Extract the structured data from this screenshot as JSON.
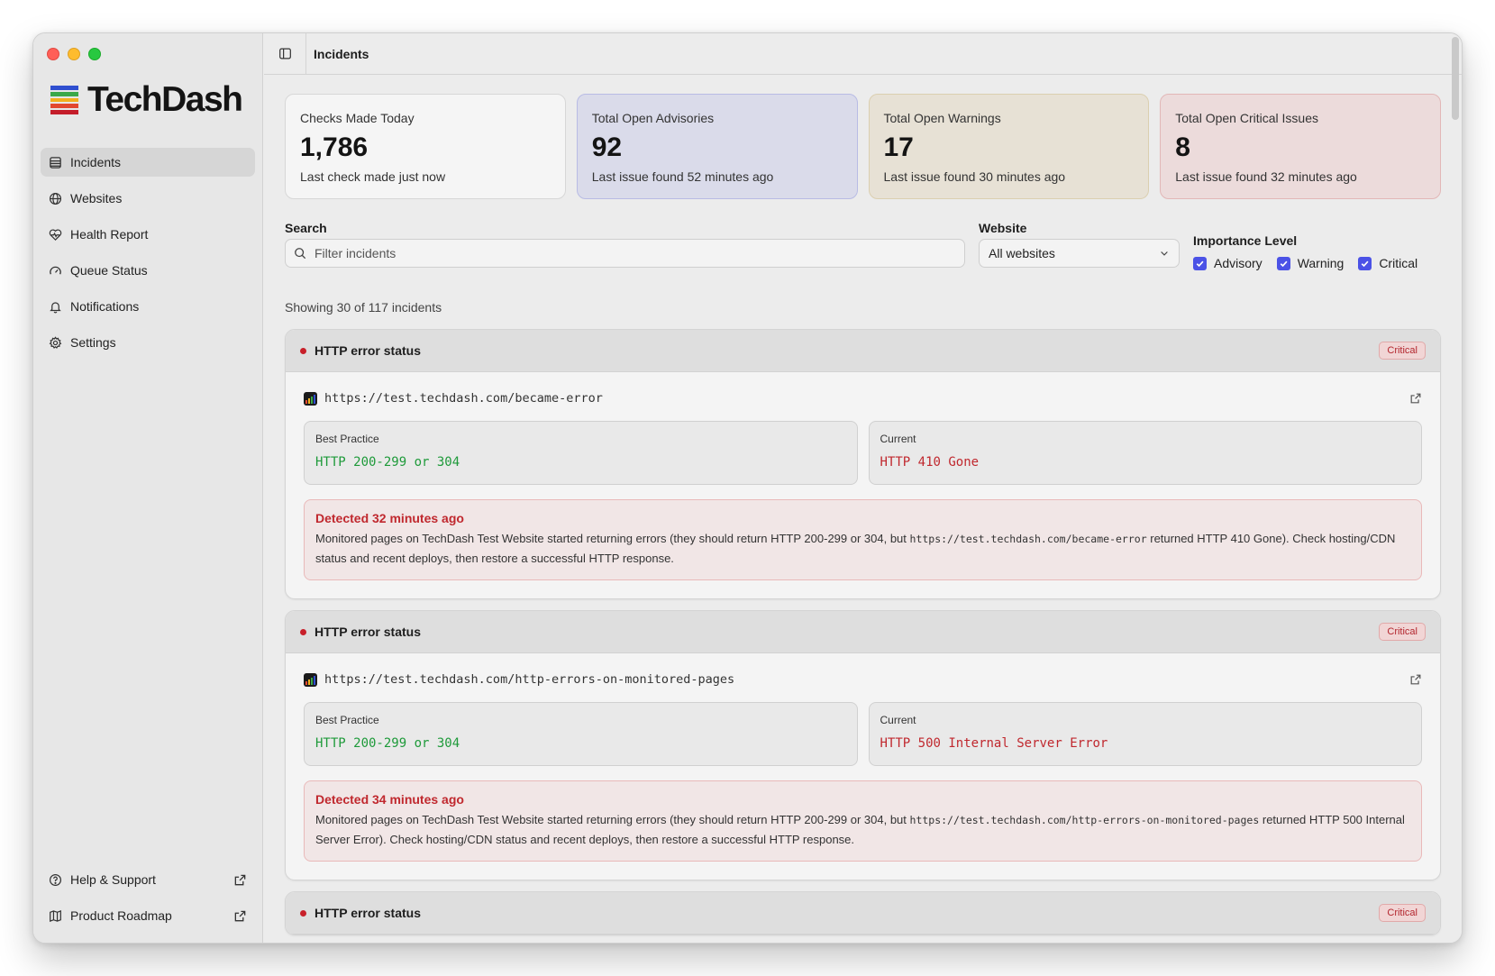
{
  "app": {
    "name": "TechDash",
    "page_title": "Incidents"
  },
  "colors": {
    "accent": "#4b52e6",
    "critical": "#c8202a",
    "good": "#1e9a3a",
    "logo": [
      "#2f4fd0",
      "#3aa84a",
      "#f2b01e",
      "#e2482f",
      "#c41d2a"
    ]
  },
  "sidebar": {
    "items": [
      {
        "label": "Incidents",
        "icon": "list-icon",
        "active": true
      },
      {
        "label": "Websites",
        "icon": "globe-icon"
      },
      {
        "label": "Health Report",
        "icon": "heart-pulse-icon"
      },
      {
        "label": "Queue Status",
        "icon": "gauge-icon"
      },
      {
        "label": "Notifications",
        "icon": "bell-icon"
      },
      {
        "label": "Settings",
        "icon": "gear-icon"
      }
    ],
    "bottom": [
      {
        "label": "Help & Support",
        "icon": "help-circle-icon"
      },
      {
        "label": "Product Roadmap",
        "icon": "map-icon"
      }
    ]
  },
  "stats": [
    {
      "label": "Checks Made Today",
      "value": "1,786",
      "sub": "Last check made just now"
    },
    {
      "label": "Total Open Advisories",
      "value": "92",
      "sub": "Last issue found 52 minutes ago"
    },
    {
      "label": "Total Open Warnings",
      "value": "17",
      "sub": "Last issue found 30 minutes ago"
    },
    {
      "label": "Total Open Critical Issues",
      "value": "8",
      "sub": "Last issue found 32 minutes ago"
    }
  ],
  "filters": {
    "search_label": "Search",
    "search_placeholder": "Filter incidents",
    "website_label": "Website",
    "website_value": "All websites",
    "importance_label": "Importance Level",
    "levels": [
      {
        "label": "Advisory",
        "checked": true
      },
      {
        "label": "Warning",
        "checked": true
      },
      {
        "label": "Critical",
        "checked": true
      }
    ]
  },
  "results_summary": "Showing 30 of 117 incidents",
  "incidents": [
    {
      "title": "HTTP error status",
      "severity": "Critical",
      "url": "https://test.techdash.com/became-error",
      "best_label": "Best Practice",
      "best_value": "HTTP 200-299 or 304",
      "current_label": "Current",
      "current_value": "HTTP 410 Gone",
      "detected": "Detected 32 minutes ago",
      "desc_before": "Monitored pages on TechDash Test Website started returning errors (they should return HTTP 200-299 or 304, but ",
      "desc_code": "https://test.techdash.com/became-error",
      "desc_after": " returned HTTP 410 Gone). Check hosting/CDN status and recent deploys, then restore a successful HTTP response."
    },
    {
      "title": "HTTP error status",
      "severity": "Critical",
      "url": "https://test.techdash.com/http-errors-on-monitored-pages",
      "best_label": "Best Practice",
      "best_value": "HTTP 200-299 or 304",
      "current_label": "Current",
      "current_value": "HTTP 500 Internal Server Error",
      "detected": "Detected 34 minutes ago",
      "desc_before": "Monitored pages on TechDash Test Website started returning errors (they should return HTTP 200-299 or 304, but ",
      "desc_code": "https://test.techdash.com/http-errors-on-monitored-pages",
      "desc_after": " returned HTTP 500 Internal Server Error). Check hosting/CDN status and recent deploys, then restore a successful HTTP response."
    },
    {
      "title": "HTTP error status",
      "severity": "Critical"
    }
  ]
}
